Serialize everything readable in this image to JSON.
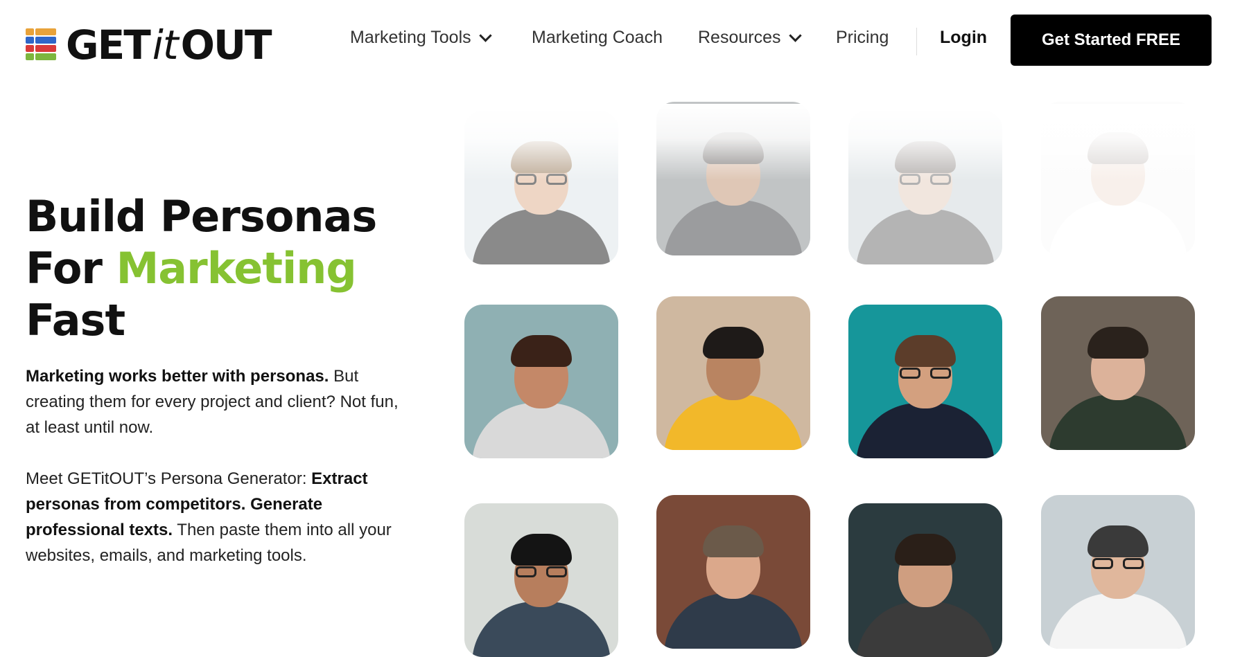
{
  "brand": {
    "logo_text_get": "GET",
    "logo_text_it": "it",
    "logo_text_out": "OUT",
    "logo_colors": [
      "#e8a23a",
      "#2f66c8",
      "#d93a3a",
      "#7db63e"
    ]
  },
  "nav": {
    "items": [
      {
        "label": "Marketing Tools",
        "has_dropdown": true
      },
      {
        "label": "Marketing Coach",
        "has_dropdown": false
      },
      {
        "label": "Resources",
        "has_dropdown": true
      },
      {
        "label": "Pricing",
        "has_dropdown": false
      }
    ],
    "login_label": "Login",
    "cta_label": "Get Started FREE"
  },
  "hero": {
    "title_line1": "Build Personas",
    "title_line2_prefix": "For ",
    "title_line2_highlight": "Marketing",
    "title_line3": "Fast",
    "highlight_color": "#86c232",
    "p1_bold": "Marketing works better with personas.",
    "p1_rest": " But creating them for every project and client? Not fun, at least until now.",
    "p2_prefix": "Meet GETitOUT’s Persona Generator: ",
    "p2_bold": "Extract personas from competitors. Generate professional texts.",
    "p2_rest": " Then paste them into all your websites, emails, and marketing tools."
  },
  "personas": [
    {
      "name": "persona-woman-glasses-longhair",
      "bg": "#dfe6ea",
      "skin": "#e1b596",
      "hair": "#8a6a44",
      "shirt": "#2b2b2b",
      "glasses": true,
      "faded": "fade"
    },
    {
      "name": "persona-man-dark-jacket",
      "bg": "#8f9497",
      "skin": "#c69a7b",
      "hair": "#2a2522",
      "shirt": "#4a4d4f",
      "glasses": false,
      "faded": "fade"
    },
    {
      "name": "persona-man-leather-jacket",
      "bg": "#b9c4ca",
      "skin": "#d8b8a2",
      "hair": "#3a2f27",
      "shirt": "#2a2a2a",
      "glasses": true,
      "faded": "fade2"
    },
    {
      "name": "persona-woman-white-top",
      "bg": "#f2f2f2",
      "skin": "#e3c0a8",
      "hair": "#5a4a3e",
      "shirt": "#ffffff",
      "glasses": false,
      "faded": "fade3"
    },
    {
      "name": "persona-woman-curly-hair",
      "bg": "#8fb0b3",
      "skin": "#c48868",
      "hair": "#3a2218",
      "shirt": "#d9d9d9",
      "glasses": false,
      "faded": ""
    },
    {
      "name": "persona-man-yellow-shirt",
      "bg": "#cfb8a0",
      "skin": "#b98461",
      "hair": "#1e1a18",
      "shirt": "#f2b82a",
      "glasses": false,
      "faded": ""
    },
    {
      "name": "persona-man-teal-backdrop",
      "bg": "#16969a",
      "skin": "#d3a07f",
      "hair": "#5c3d2a",
      "shirt": "#1b2234",
      "glasses": true,
      "faded": ""
    },
    {
      "name": "persona-man-wood-backdrop",
      "bg": "#6e6358",
      "skin": "#dcb29a",
      "hair": "#2a221c",
      "shirt": "#2d3b2f",
      "glasses": false,
      "faded": ""
    },
    {
      "name": "persona-man-glasses-beard",
      "bg": "#d8dcd8",
      "skin": "#b77e5d",
      "hair": "#141414",
      "shirt": "#3a4a5a",
      "glasses": true,
      "faded": ""
    },
    {
      "name": "persona-man-brick-wall",
      "bg": "#7a4a38",
      "skin": "#dba88b",
      "hair": "#6b5a4a",
      "shirt": "#2f3b4a",
      "glasses": false,
      "faded": ""
    },
    {
      "name": "persona-man-dark-teal",
      "bg": "#2b3b3f",
      "skin": "#cf9e80",
      "hair": "#2a1f18",
      "shirt": "#3b3b3b",
      "glasses": false,
      "faded": ""
    },
    {
      "name": "persona-man-black-glasses",
      "bg": "#c8d0d4",
      "skin": "#e0b79c",
      "hair": "#3a3a3a",
      "shirt": "#f4f4f4",
      "glasses": true,
      "faded": ""
    }
  ]
}
